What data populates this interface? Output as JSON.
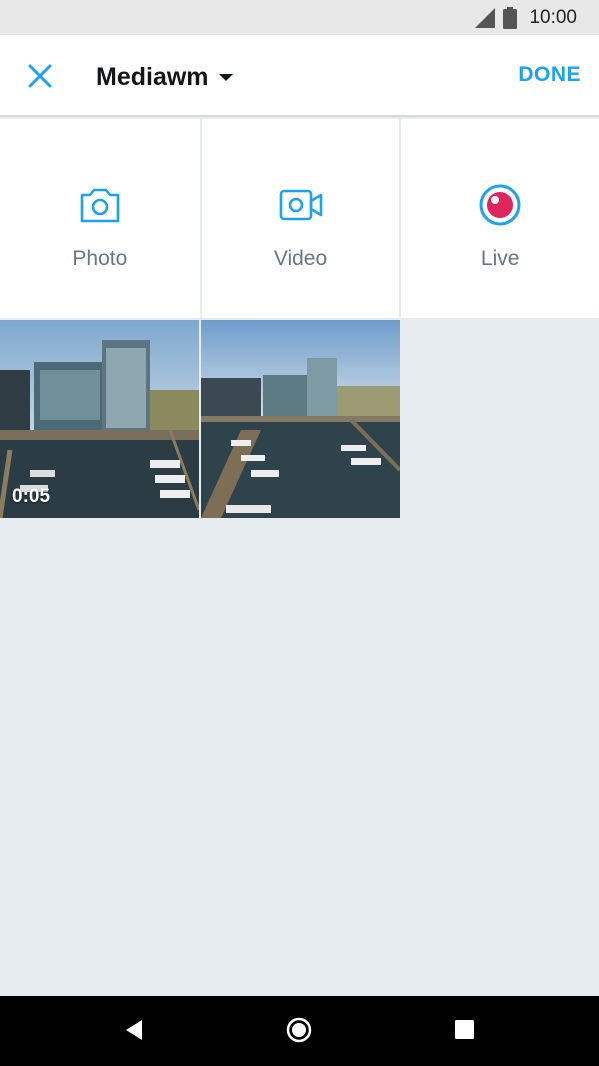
{
  "status_bar": {
    "time": "10:00",
    "icons": [
      "signal-icon",
      "battery-icon"
    ]
  },
  "app_bar": {
    "close_icon": "close-icon",
    "album_title": "Mediawm",
    "dropdown_icon": "caret-down-icon",
    "done_label": "DONE",
    "accent_color": "#1da1f2"
  },
  "capture_options": [
    {
      "label": "Photo",
      "icon": "camera-icon"
    },
    {
      "label": "Video",
      "icon": "video-camera-icon"
    },
    {
      "label": "Live",
      "icon": "live-periscope-icon"
    }
  ],
  "media": [
    {
      "type": "video",
      "duration": "0:05"
    },
    {
      "type": "photo"
    }
  ],
  "nav_bar": {
    "buttons": [
      "back-icon",
      "home-icon",
      "recents-icon"
    ]
  }
}
